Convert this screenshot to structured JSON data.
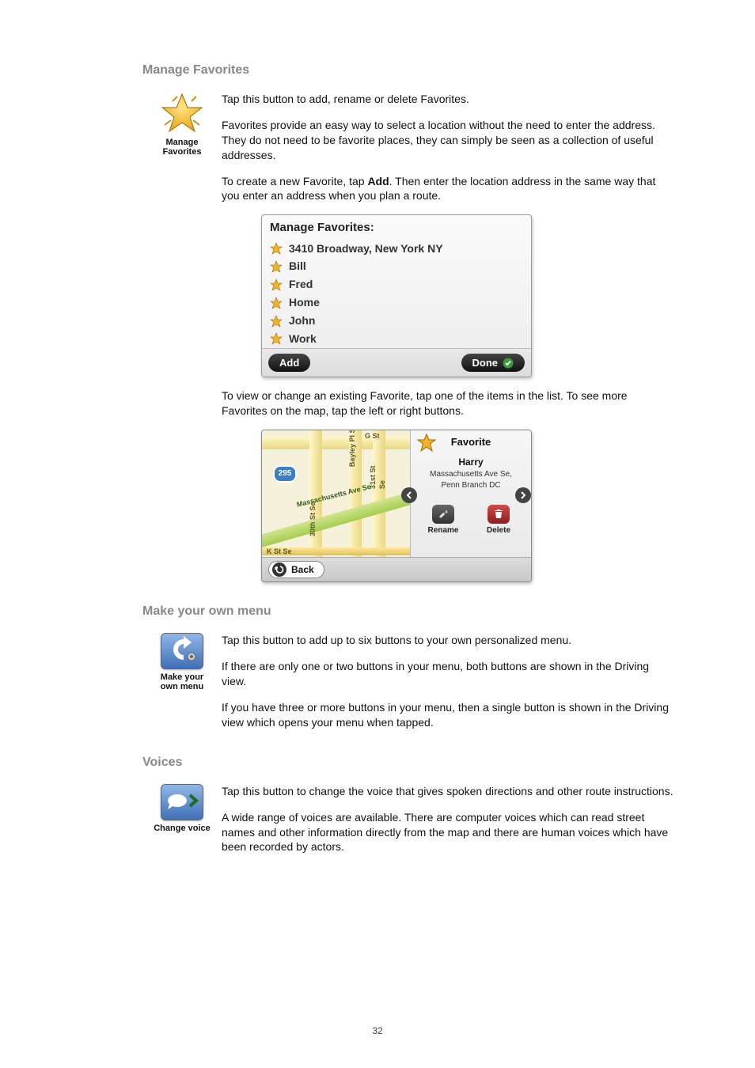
{
  "page_number": "32",
  "sections": {
    "manage_favorites": {
      "heading": "Manage Favorites",
      "icon_label_line1": "Manage",
      "icon_label_line2": "Favorites",
      "p1": "Tap this button to add, rename or delete Favorites.",
      "p2": "Favorites provide an easy way to select a location without the need to enter the address. They do not need to be favorite places, they can simply be seen as a collection of useful addresses.",
      "p3_a": "To create a new Favorite, tap ",
      "p3_bold": "Add",
      "p3_b": ". Then enter the location address in the same way that you enter an address when you plan a route.",
      "panel": {
        "title": "Manage Favorites:",
        "items": [
          "3410 Broadway, New York NY",
          "Bill",
          "Fred",
          "Home",
          "John",
          "Work"
        ],
        "add_label": "Add",
        "done_label": "Done"
      },
      "p4": "To view or change an existing Favorite, tap one of the items in the list. To see more Favorites on the map, tap the left or right buttons.",
      "map": {
        "shield": "295",
        "road1": "Massachusetts Ave Se",
        "road2": "G St",
        "road3": "Bayley Pl S",
        "road4": "31st St Se",
        "road5": "30th St Se",
        "road6": "K St Se",
        "side_title": "Favorite",
        "side_name": "Harry",
        "side_addr1": "Massachusetts Ave Se,",
        "side_addr2": "Penn Branch DC",
        "tool_rename": "Rename",
        "tool_delete": "Delete",
        "back": "Back"
      }
    },
    "make_menu": {
      "heading": "Make your own menu",
      "icon_label_line1": "Make your",
      "icon_label_line2": "own menu",
      "p1": "Tap this button to add up to six buttons to your own personalized menu.",
      "p2": "If there are only one or two buttons in your menu, both buttons are shown in the Driving view.",
      "p3": "If you have three or more buttons in your menu, then a single button is shown in the Driving view which opens your menu when tapped."
    },
    "voices": {
      "heading": "Voices",
      "icon_label": "Change voice",
      "p1": "Tap this button to change the voice that gives spoken directions and other route instructions.",
      "p2": "A wide range of voices are available. There are computer voices which can read street names and other information directly from the map and there are human voices which have been recorded by actors."
    }
  }
}
